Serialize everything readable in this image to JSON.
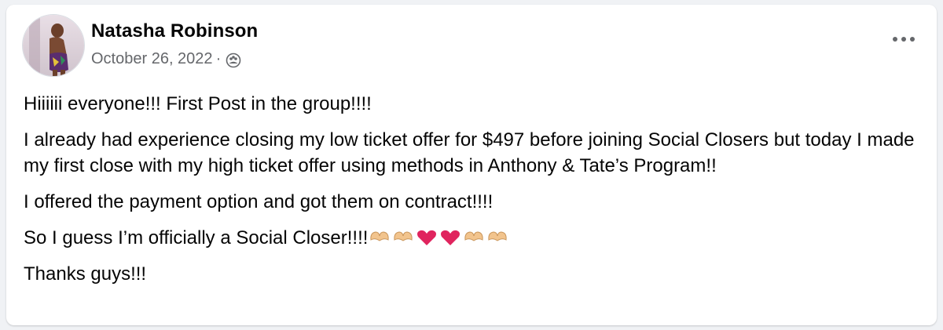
{
  "post": {
    "author": "Natasha Robinson",
    "date": "October 26, 2022",
    "separator": "·",
    "privacy_icon": "group-members-icon",
    "more_icon": "more-horizontal-icon",
    "paragraphs": [
      "Hiiiiii everyone!!! First Post in the group!!!!",
      "I already had experience closing my low ticket offer for $497 before joining Social Closers but today I made my first close with my high ticket offer using methods in Anthony & Tate’s Program!!",
      "I offered the payment option and got them on contract!!!!",
      "So I guess I’m officially a Social Closer!!!!",
      "Thanks guys!!!"
    ],
    "emojis": [
      "heart-hands-emoji",
      "heart-hands-emoji",
      "red-heart-emoji",
      "red-heart-emoji",
      "heart-hands-emoji",
      "heart-hands-emoji"
    ]
  },
  "colors": {
    "text": "#050505",
    "secondary_text": "#65676b",
    "heart": "#e0245e",
    "hands": "#f2c48d"
  }
}
